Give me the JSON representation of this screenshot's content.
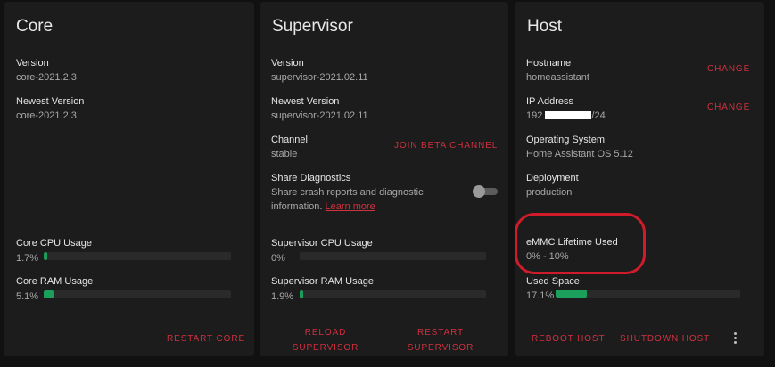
{
  "core": {
    "title": "Core",
    "version_label": "Version",
    "version_value": "core-2021.2.3",
    "newest_label": "Newest Version",
    "newest_value": "core-2021.2.3",
    "cpu_label": "Core CPU Usage",
    "cpu_value": "1.7%",
    "cpu_percent": 1.7,
    "ram_label": "Core RAM Usage",
    "ram_value": "5.1%",
    "ram_percent": 5.1,
    "restart_label": "RESTART CORE"
  },
  "supervisor": {
    "title": "Supervisor",
    "version_label": "Version",
    "version_value": "supervisor-2021.02.11",
    "newest_label": "Newest Version",
    "newest_value": "supervisor-2021.02.11",
    "channel_label": "Channel",
    "channel_value": "stable",
    "join_beta_label": "JOIN BETA CHANNEL",
    "diagnostics_label": "Share Diagnostics",
    "diagnostics_desc": "Share crash reports and diagnostic information.",
    "learn_more": "Learn more",
    "diagnostics_enabled": false,
    "cpu_label": "Supervisor CPU Usage",
    "cpu_value": "0%",
    "cpu_percent": 0,
    "ram_label": "Supervisor RAM Usage",
    "ram_value": "1.9%",
    "ram_percent": 1.9,
    "reload_line1": "RELOAD",
    "reload_line2": "SUPERVISOR",
    "restart_line1": "RESTART",
    "restart_line2": "SUPERVISOR"
  },
  "host": {
    "title": "Host",
    "hostname_label": "Hostname",
    "hostname_value": "homeassistant",
    "change_hostname": "CHANGE",
    "ip_label": "IP Address",
    "ip_prefix": "192.",
    "ip_suffix": "/24",
    "change_ip": "CHANGE",
    "os_label": "Operating System",
    "os_value": "Home Assistant OS 5.12",
    "deployment_label": "Deployment",
    "deployment_value": "production",
    "emmc_label": "eMMC Lifetime Used",
    "emmc_value": "0% - 10%",
    "used_space_label": "Used Space",
    "used_space_value": "17.1%",
    "used_space_percent": 17.1,
    "reboot_label": "REBOOT HOST",
    "shutdown_label": "SHUTDOWN HOST"
  },
  "colors": {
    "accent": "#d1303e",
    "bar_fill": "#1aa05a",
    "highlight": "#d01c2a"
  }
}
